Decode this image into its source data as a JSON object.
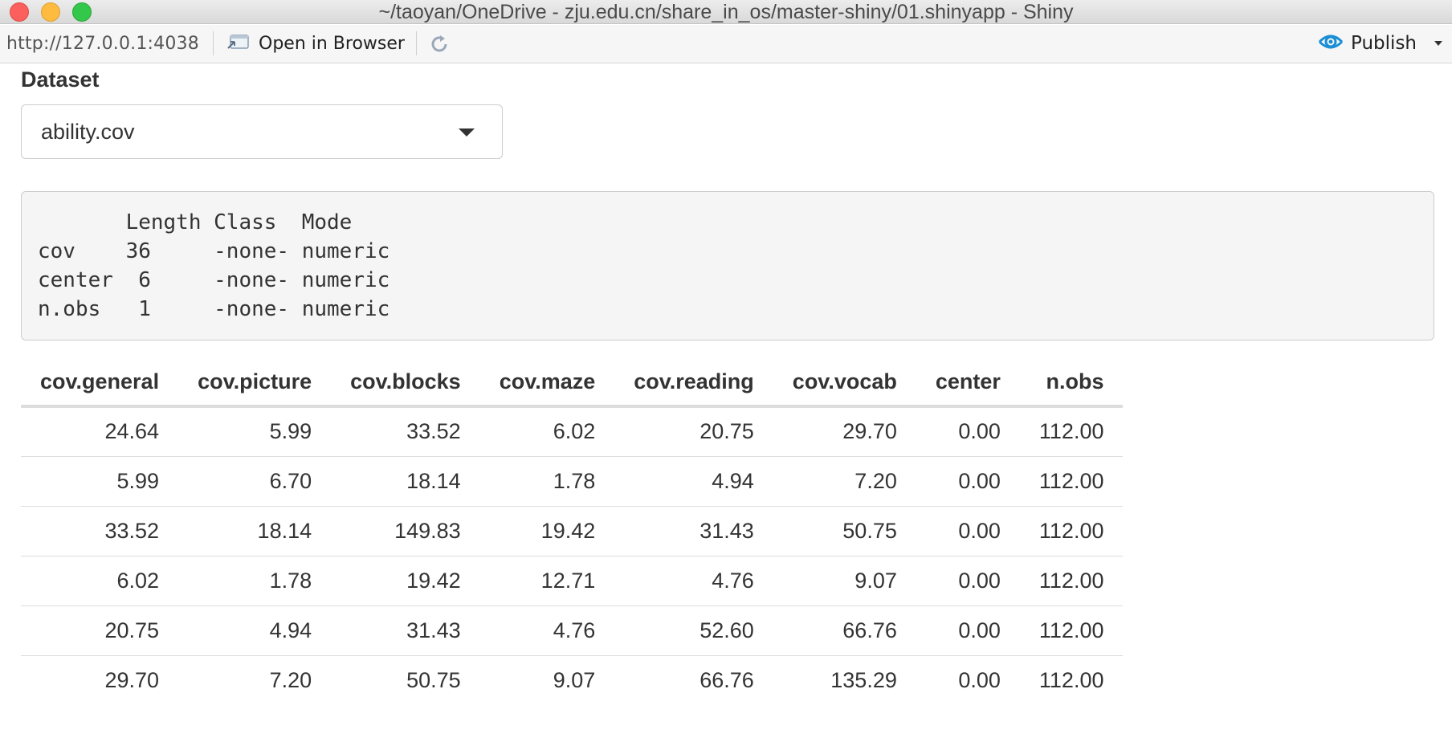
{
  "window": {
    "title": "~/taoyan/OneDrive - zju.edu.cn/share_in_os/master-shiny/01.shinyapp - Shiny"
  },
  "toolbar": {
    "url": "http://127.0.0.1:4038",
    "open_browser_label": "Open in Browser",
    "publish_label": "Publish",
    "icons": [
      "open-browser-icon",
      "refresh-icon",
      "publish-icon",
      "chevron-down-icon"
    ]
  },
  "input": {
    "label": "Dataset",
    "selected": "ability.cov"
  },
  "summary_output": {
    "lines": [
      "       Length Class  Mode   ",
      "cov    36     -none- numeric",
      "center  6     -none- numeric",
      "n.obs   1     -none- numeric"
    ]
  },
  "table": {
    "columns": [
      "cov.general",
      "cov.picture",
      "cov.blocks",
      "cov.maze",
      "cov.reading",
      "cov.vocab",
      "center",
      "n.obs"
    ],
    "rows": [
      [
        "24.64",
        "5.99",
        "33.52",
        "6.02",
        "20.75",
        "29.70",
        "0.00",
        "112.00"
      ],
      [
        "5.99",
        "6.70",
        "18.14",
        "1.78",
        "4.94",
        "7.20",
        "0.00",
        "112.00"
      ],
      [
        "33.52",
        "18.14",
        "149.83",
        "19.42",
        "31.43",
        "50.75",
        "0.00",
        "112.00"
      ],
      [
        "6.02",
        "1.78",
        "19.42",
        "12.71",
        "4.76",
        "9.07",
        "0.00",
        "112.00"
      ],
      [
        "20.75",
        "4.94",
        "31.43",
        "4.76",
        "52.60",
        "66.76",
        "0.00",
        "112.00"
      ],
      [
        "29.70",
        "7.20",
        "50.75",
        "9.07",
        "66.76",
        "135.29",
        "0.00",
        "112.00"
      ]
    ]
  },
  "colors": {
    "close": "#fc605c",
    "minimize": "#fdbc40",
    "zoom": "#34c84a",
    "publish_accent": "#1a8fd6"
  }
}
